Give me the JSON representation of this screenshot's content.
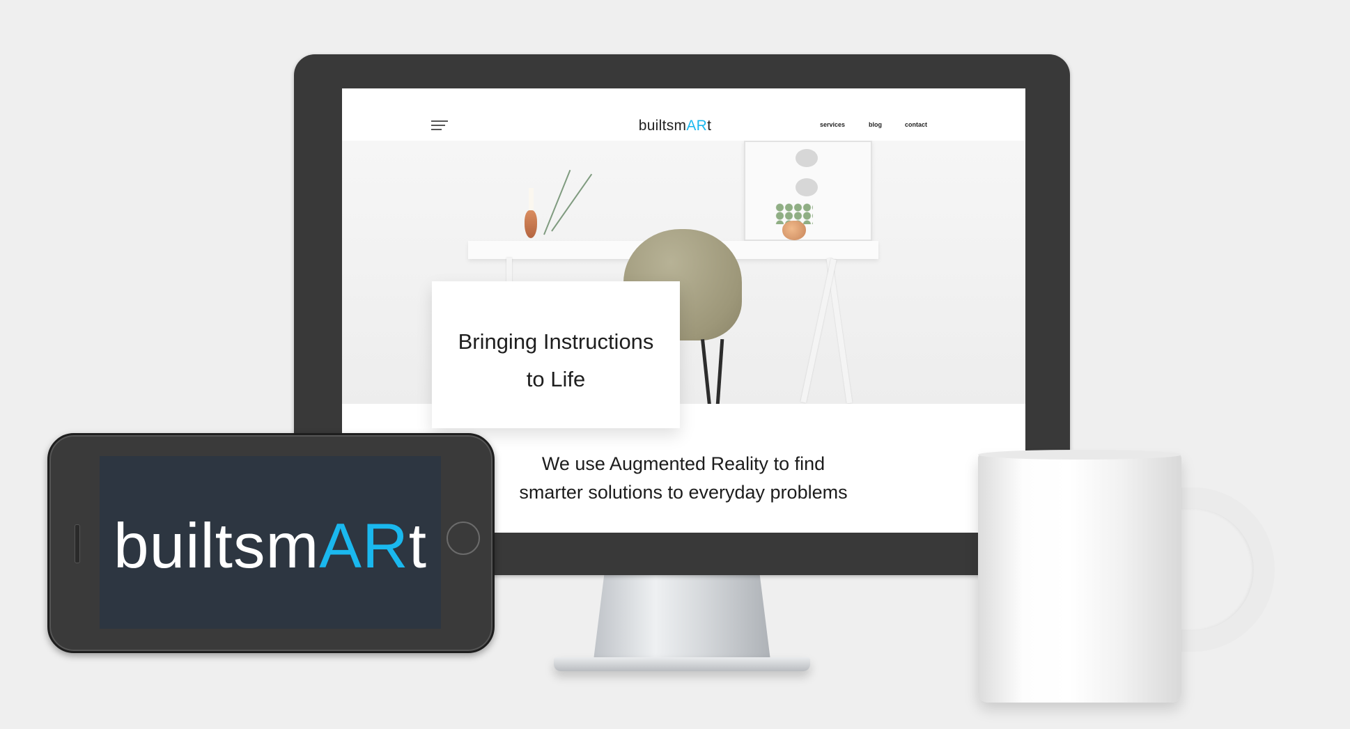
{
  "website": {
    "logo_prefix": "builtsm",
    "logo_accent": "AR",
    "logo_suffix": "t",
    "nav_links": [
      "services",
      "blog",
      "contact"
    ],
    "hero_title_line1": "Bringing Instructions",
    "hero_title_line2": "to Life",
    "tagline_line1": "We use Augmented Reality to find",
    "tagline_line2": "smarter solutions to everyday problems"
  },
  "phone": {
    "logo_prefix": "builtsm",
    "logo_accent": "AR",
    "logo_suffix": "t"
  },
  "colors": {
    "accent": "#1ab8ee",
    "phone_screen": "#2d3641",
    "monitor_bezel": "#393939",
    "background": "#efefef"
  },
  "icons": [
    "hamburger-menu-icon"
  ]
}
